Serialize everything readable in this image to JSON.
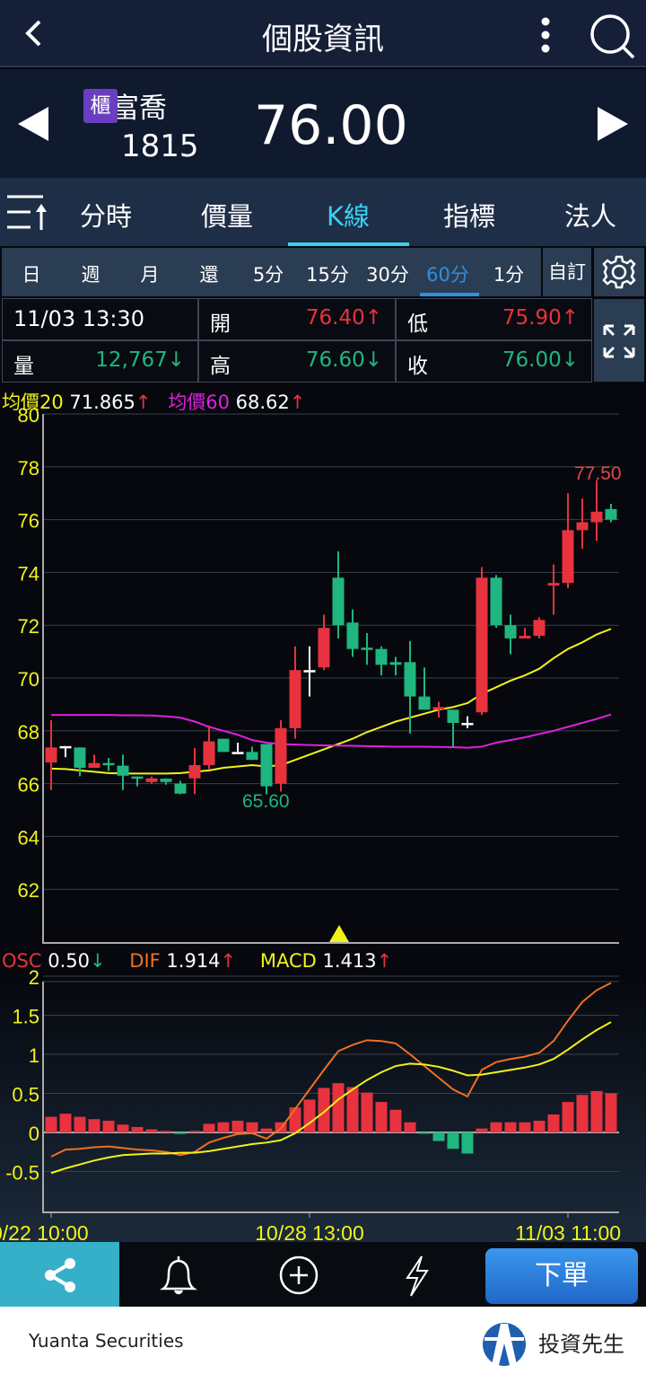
{
  "header": {
    "title": "個股資訊",
    "back_icon": "chevron-left-icon",
    "menu_icon": "more-vertical-icon",
    "search_icon": "search-icon"
  },
  "stock": {
    "name": "富喬",
    "market_badge": "櫃",
    "code": "1815",
    "price": "76.00"
  },
  "tabs": [
    {
      "label": "分時"
    },
    {
      "label": "價量"
    },
    {
      "label": "K線",
      "active": true
    },
    {
      "label": "指標"
    },
    {
      "label": "法人"
    }
  ],
  "periods": [
    {
      "label": "日"
    },
    {
      "label": "週"
    },
    {
      "label": "月"
    },
    {
      "label": "還"
    },
    {
      "label": "5分"
    },
    {
      "label": "15分"
    },
    {
      "label": "30分"
    },
    {
      "label": "60分",
      "active": true
    },
    {
      "label": "1分"
    }
  ],
  "custom_label": "自訂",
  "info": {
    "datetime": "11/03 13:30",
    "open_label": "開",
    "open": "76.40↑",
    "low_label": "低",
    "low": "75.90↑",
    "volume_label": "量",
    "volume": "12,767↓",
    "high_label": "高",
    "high": "76.60↓",
    "close_label": "收",
    "close": "76.00↓"
  },
  "ma_legend": {
    "ma20_label": "均價20",
    "ma20_value": "71.865",
    "ma60_label": "均價60",
    "ma60_value": "68.62",
    "arrow": "↑"
  },
  "macd_legend": {
    "osc_label": "OSC",
    "osc_value": "0.50",
    "osc_arrow": "↓",
    "dif_label": "DIF",
    "dif_value": "1.914",
    "dif_arrow": "↑",
    "macd_label": "MACD",
    "macd_value": "1.413",
    "macd_arrow": "↑"
  },
  "colors": {
    "up": "#e8323e",
    "down": "#1fb67f",
    "ma20": "#f2f21a",
    "ma60": "#e020e0",
    "dif": "#f07020",
    "macd": "#f2f21a",
    "accent": "#3ad0ef"
  },
  "chart_data": [
    {
      "type": "candlestick",
      "title": "K線 60分",
      "ylim": [
        60,
        80
      ],
      "yticks": [
        "80",
        "78",
        "76",
        "74",
        "72",
        "70",
        "68",
        "66",
        "64",
        "62"
      ],
      "annotations": {
        "high": "77.50",
        "low": "65.60"
      },
      "ohlc": [
        [
          66.8,
          68.4,
          65.76,
          67.37
        ],
        [
          67.42,
          67.42,
          67.0,
          67.42
        ],
        [
          67.37,
          67.37,
          66.28,
          66.6
        ],
        [
          66.6,
          67.1,
          66.6,
          66.78
        ],
        [
          66.78,
          66.97,
          66.48,
          66.7
        ],
        [
          66.68,
          67.1,
          65.76,
          66.3
        ],
        [
          66.27,
          66.27,
          65.9,
          66.19
        ],
        [
          66.06,
          66.27,
          66.0,
          66.2
        ],
        [
          66.19,
          66.2,
          65.96,
          66.06
        ],
        [
          66.0,
          66.1,
          65.6,
          65.62
        ],
        [
          66.2,
          67.35,
          65.6,
          66.7
        ],
        [
          66.7,
          68.2,
          66.55,
          67.6
        ],
        [
          67.7,
          67.7,
          67.2,
          67.2
        ],
        [
          67.2,
          67.55,
          67.2,
          67.2
        ],
        [
          67.2,
          67.4,
          66.9,
          66.9
        ],
        [
          67.5,
          67.5,
          65.6,
          65.9
        ],
        [
          66.0,
          68.4,
          65.7,
          68.1
        ],
        [
          68.1,
          71.2,
          67.7,
          70.3
        ],
        [
          70.3,
          71.2,
          69.3,
          70.3
        ],
        [
          70.4,
          72.4,
          70.3,
          71.9
        ],
        [
          73.8,
          74.8,
          71.5,
          72.0
        ],
        [
          72.1,
          72.6,
          70.8,
          71.1
        ],
        [
          71.15,
          71.7,
          70.5,
          71.1
        ],
        [
          71.1,
          71.2,
          70.1,
          70.5
        ],
        [
          70.6,
          70.8,
          70.1,
          70.5
        ],
        [
          70.6,
          71.4,
          67.9,
          69.3
        ],
        [
          69.3,
          70.4,
          68.8,
          68.8
        ],
        [
          68.8,
          69.1,
          68.5,
          68.9
        ],
        [
          68.8,
          68.8,
          67.4,
          68.3
        ],
        [
          68.3,
          68.55,
          68.1,
          68.3
        ],
        [
          68.7,
          74.2,
          68.6,
          73.8
        ],
        [
          73.8,
          73.9,
          71.9,
          72.0
        ],
        [
          72.0,
          72.4,
          70.9,
          71.5
        ],
        [
          71.5,
          71.9,
          71.5,
          71.6
        ],
        [
          71.6,
          72.3,
          71.5,
          72.2
        ],
        [
          73.5,
          74.3,
          72.4,
          73.6
        ],
        [
          73.6,
          77.0,
          73.4,
          75.6
        ],
        [
          75.6,
          76.8,
          74.9,
          75.9
        ],
        [
          75.9,
          77.5,
          75.2,
          76.3
        ],
        [
          76.4,
          76.6,
          75.9,
          76.0
        ]
      ],
      "series": [
        {
          "name": "均價20",
          "values": [
            66.57,
            66.55,
            66.5,
            66.45,
            66.4,
            66.38,
            66.38,
            66.38,
            66.38,
            66.4,
            66.45,
            66.5,
            66.6,
            66.65,
            66.7,
            66.65,
            66.7,
            66.9,
            67.1,
            67.3,
            67.5,
            67.7,
            67.95,
            68.15,
            68.35,
            68.5,
            68.65,
            68.8,
            68.9,
            69.05,
            69.4,
            69.65,
            69.9,
            70.1,
            70.35,
            70.75,
            71.1,
            71.35,
            71.65,
            71.86
          ]
        },
        {
          "name": "均價60",
          "values": [
            68.6,
            68.6,
            68.6,
            68.6,
            68.6,
            68.59,
            68.59,
            68.58,
            68.55,
            68.5,
            68.35,
            68.15,
            68.0,
            67.85,
            67.65,
            67.55,
            67.5,
            67.48,
            67.46,
            67.45,
            67.44,
            67.43,
            67.42,
            67.41,
            67.4,
            67.4,
            67.4,
            67.39,
            67.38,
            67.36,
            67.4,
            67.55,
            67.65,
            67.75,
            67.88,
            68.0,
            68.15,
            68.3,
            68.45,
            68.62
          ]
        }
      ]
    },
    {
      "type": "bar+line",
      "title": "MACD",
      "ylim": [
        -1,
        2
      ],
      "yticks": [
        "2",
        "1.5",
        "1",
        "0.5",
        "0",
        "-0.5"
      ],
      "xticks": [
        {
          "index": 0,
          "label": "0/22 10:00"
        },
        {
          "index": 18,
          "label": "10/28 13:00"
        },
        {
          "index": 36,
          "label": "11/03 11:00"
        }
      ],
      "series": [
        {
          "name": "OSC",
          "values": [
            0.2,
            0.24,
            0.2,
            0.17,
            0.15,
            0.1,
            0.07,
            0.04,
            0.02,
            -0.02,
            0.02,
            0.11,
            0.13,
            0.15,
            0.13,
            0.05,
            0.13,
            0.32,
            0.42,
            0.57,
            0.63,
            0.58,
            0.51,
            0.39,
            0.29,
            0.13,
            -0.01,
            -0.11,
            -0.21,
            -0.27,
            0.05,
            0.13,
            0.13,
            0.13,
            0.15,
            0.23,
            0.39,
            0.48,
            0.53,
            0.5
          ]
        },
        {
          "name": "DIF",
          "values": [
            -0.31,
            -0.22,
            -0.21,
            -0.19,
            -0.18,
            -0.2,
            -0.22,
            -0.23,
            -0.25,
            -0.29,
            -0.25,
            -0.13,
            -0.07,
            -0.02,
            -0.01,
            -0.08,
            0.05,
            0.3,
            0.55,
            0.8,
            1.04,
            1.12,
            1.18,
            1.17,
            1.14,
            1.0,
            0.85,
            0.7,
            0.55,
            0.46,
            0.8,
            0.9,
            0.94,
            0.97,
            1.02,
            1.17,
            1.43,
            1.67,
            1.82,
            1.914
          ]
        },
        {
          "name": "MACD",
          "values": [
            -0.52,
            -0.46,
            -0.41,
            -0.36,
            -0.32,
            -0.29,
            -0.28,
            -0.27,
            -0.27,
            -0.26,
            -0.26,
            -0.24,
            -0.21,
            -0.18,
            -0.15,
            -0.13,
            -0.1,
            -0.01,
            0.12,
            0.26,
            0.42,
            0.55,
            0.67,
            0.77,
            0.85,
            0.88,
            0.87,
            0.84,
            0.79,
            0.73,
            0.74,
            0.77,
            0.8,
            0.83,
            0.87,
            0.94,
            1.06,
            1.19,
            1.31,
            1.413
          ]
        }
      ]
    }
  ],
  "bottombar": {
    "order_label": "下單",
    "share_icon": "share-icon",
    "bell_icon": "bell-icon",
    "add_icon": "plus-circle-icon",
    "flash_icon": "lightning-icon"
  },
  "footer": {
    "brand": "Yuanta Securities",
    "app_name": "投資先生"
  }
}
